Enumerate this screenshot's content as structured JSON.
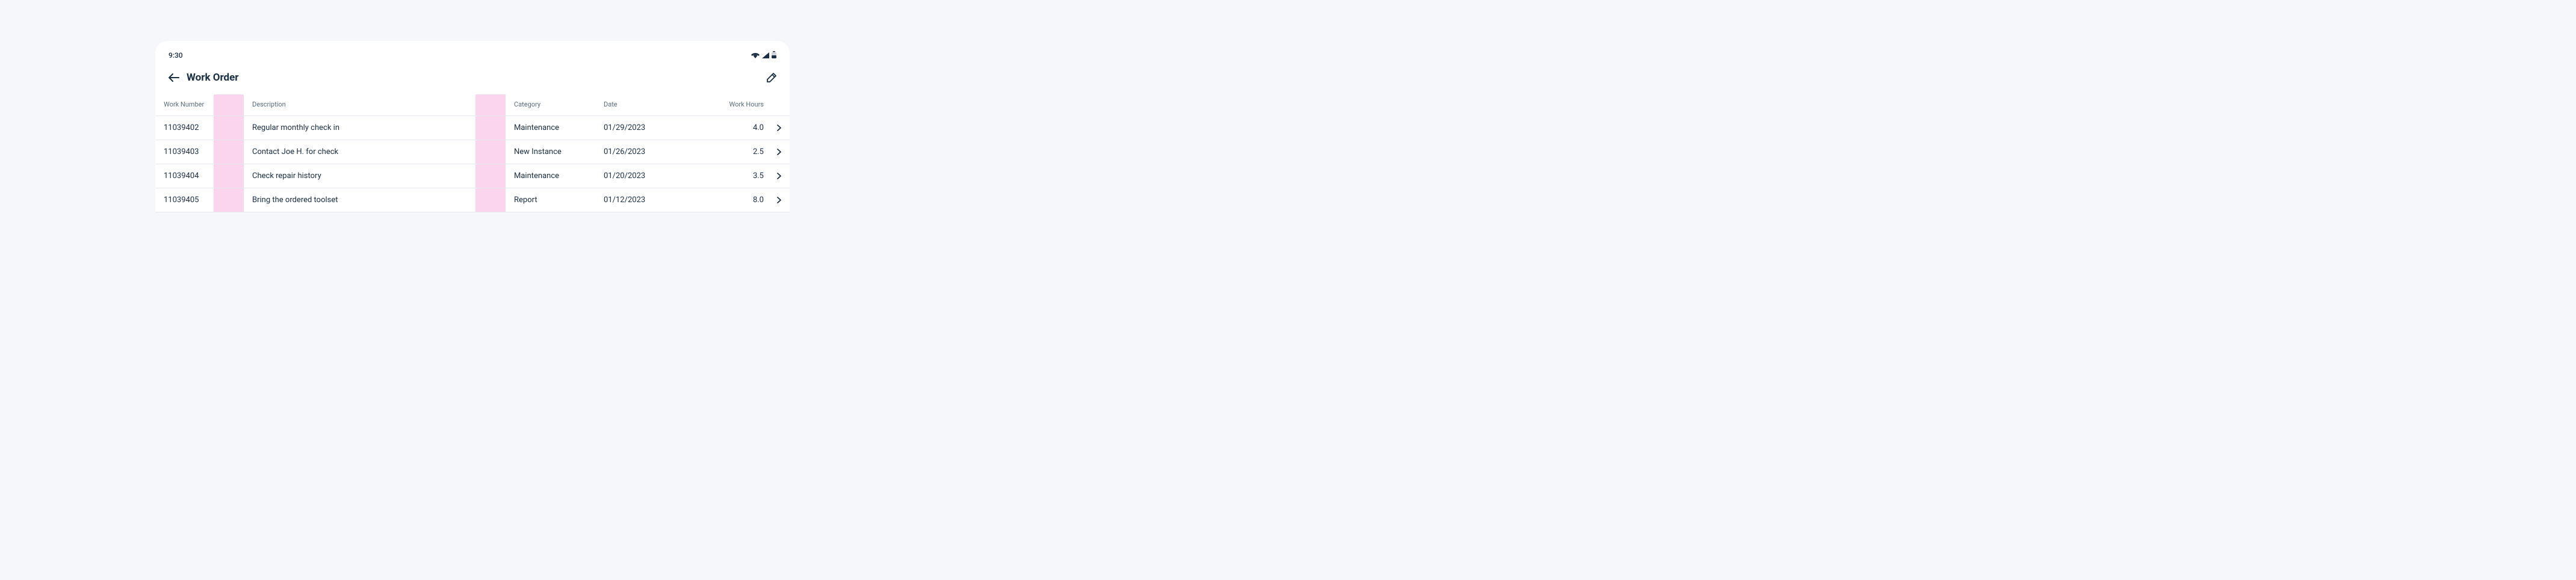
{
  "status": {
    "time": "9:30"
  },
  "header": {
    "title": "Work Order"
  },
  "table": {
    "columns": {
      "worknumber": "Work Number",
      "description": "Description",
      "category": "Category",
      "date": "Date",
      "hours": "Work Hours"
    },
    "rows": [
      {
        "worknumber": "11039402",
        "description": "Regular monthly check in",
        "category": "Maintenance",
        "date": "01/29/2023",
        "hours": "4.0"
      },
      {
        "worknumber": "11039403",
        "description": "Contact Joe H. for check",
        "category": "New Instance",
        "date": "01/26/2023",
        "hours": "2.5"
      },
      {
        "worknumber": "11039404",
        "description": "Check repair history",
        "category": "Maintenance",
        "date": "01/20/2023",
        "hours": "3.5"
      },
      {
        "worknumber": "11039405",
        "description": "Bring the ordered toolset",
        "category": "Report",
        "date": "01/12/2023",
        "hours": "8.0"
      }
    ]
  }
}
